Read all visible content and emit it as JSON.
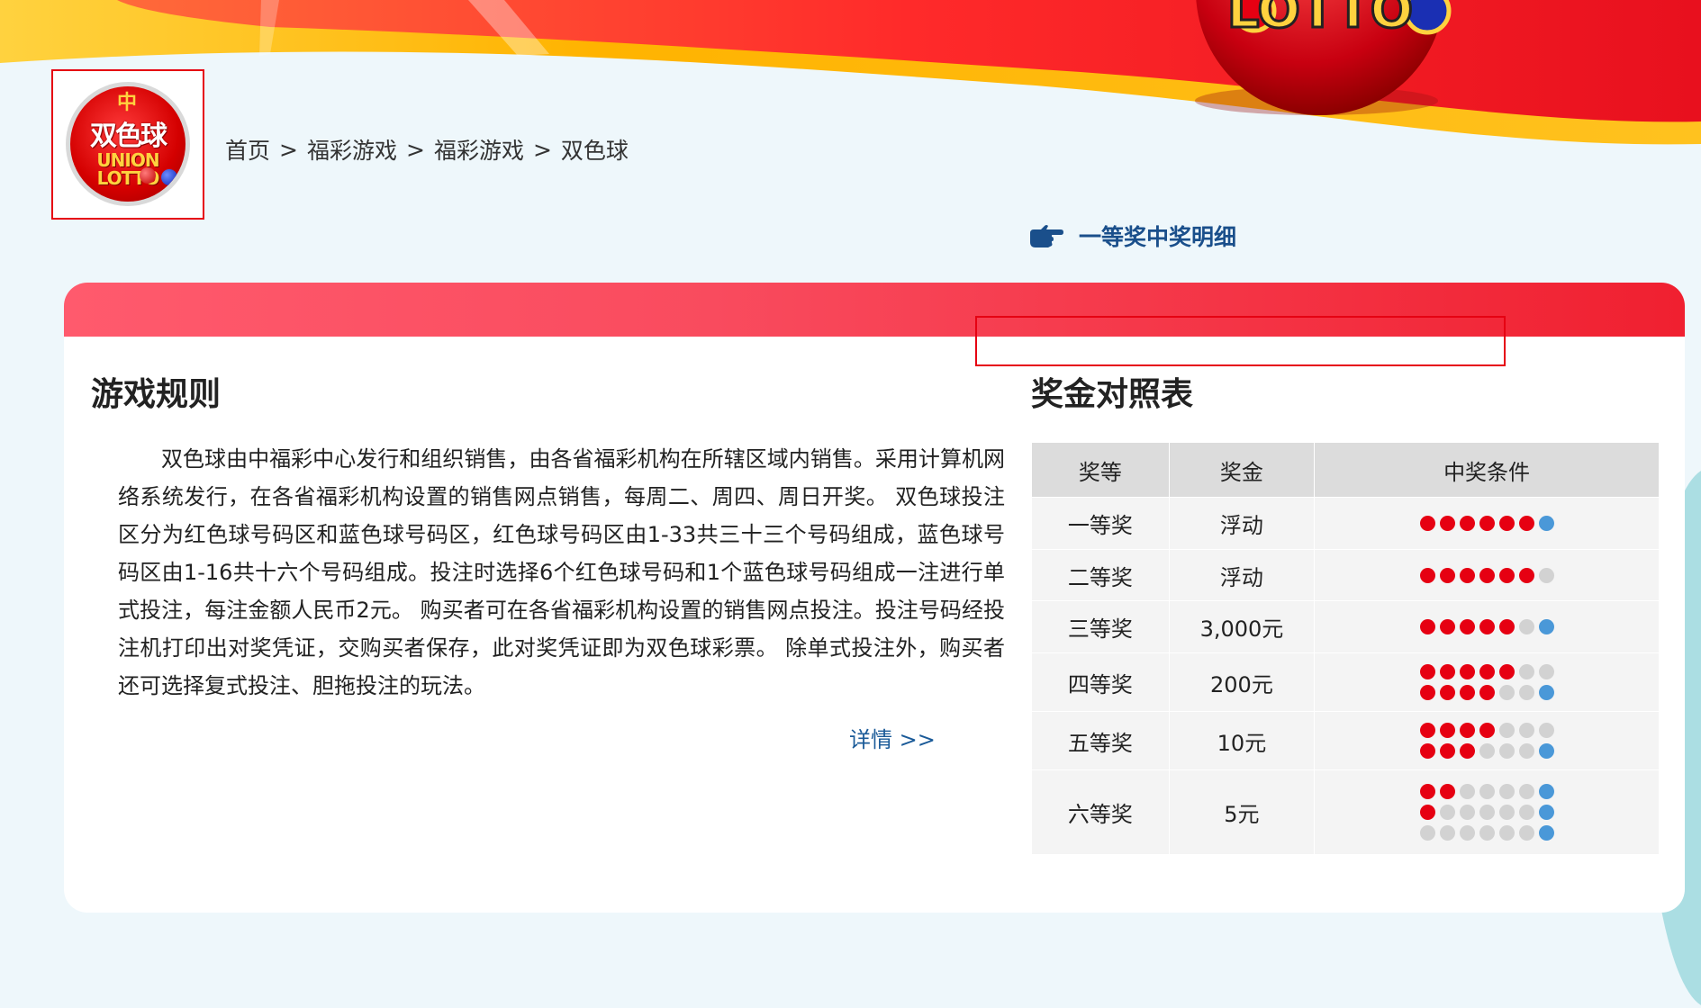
{
  "breadcrumb": {
    "items": [
      "首页",
      "福彩游戏",
      "福彩游戏",
      "双色球"
    ],
    "separator": ">"
  },
  "logo": {
    "cn": "双色球",
    "en_line1": "UNION",
    "en_line2": "LOTTO"
  },
  "banner": {
    "lotto_text": "LOTTO"
  },
  "first_prize_link": {
    "label": "一等奖中奖明细"
  },
  "rules": {
    "title": "游戏规则",
    "body": "双色球由中福彩中心发行和组织销售，由各省福彩机构在所辖区域内销售。采用计算机网络系统发行，在各省福彩机构设置的销售网点销售，每周二、周四、周日开奖。 双色球投注区分为红色球号码区和蓝色球号码区，红色球号码区由1-33共三十三个号码组成，蓝色球号码区由1-16共十六个号码组成。投注时选择6个红色球号码和1个蓝色球号码组成一注进行单式投注，每注金额人民币2元。 购买者可在各省福彩机构设置的销售网点投注。投注号码经投注机打印出对奖凭证，交购买者保存，此对奖凭证即为双色球彩票。 除单式投注外，购买者还可选择复式投注、胆拖投注的玩法。",
    "detail_link": "详情 >>"
  },
  "prize_table": {
    "title": "奖金对照表",
    "headers": [
      "奖等",
      "奖金",
      "中奖条件"
    ],
    "rows": [
      {
        "level": "一等奖",
        "amount": "浮动",
        "conditions": [
          [
            6,
            0,
            1
          ]
        ]
      },
      {
        "level": "二等奖",
        "amount": "浮动",
        "conditions": [
          [
            6,
            1,
            0
          ]
        ]
      },
      {
        "level": "三等奖",
        "amount": "3,000元",
        "conditions": [
          [
            5,
            1,
            1
          ]
        ]
      },
      {
        "level": "四等奖",
        "amount": "200元",
        "conditions": [
          [
            5,
            2,
            0
          ],
          [
            4,
            2,
            1
          ]
        ]
      },
      {
        "level": "五等奖",
        "amount": "10元",
        "conditions": [
          [
            4,
            3,
            0
          ],
          [
            3,
            3,
            1
          ]
        ]
      },
      {
        "level": "六等奖",
        "amount": "5元",
        "conditions": [
          [
            2,
            4,
            1
          ],
          [
            1,
            5,
            1
          ],
          [
            0,
            6,
            1
          ]
        ]
      }
    ],
    "highlighted_row": 2
  },
  "colors": {
    "red_ball": "#e60012",
    "blue_ball": "#4a98d8",
    "grey_ball": "#d2d2d2",
    "accent_red": "#e60012",
    "link_blue": "#1a4f8b"
  }
}
